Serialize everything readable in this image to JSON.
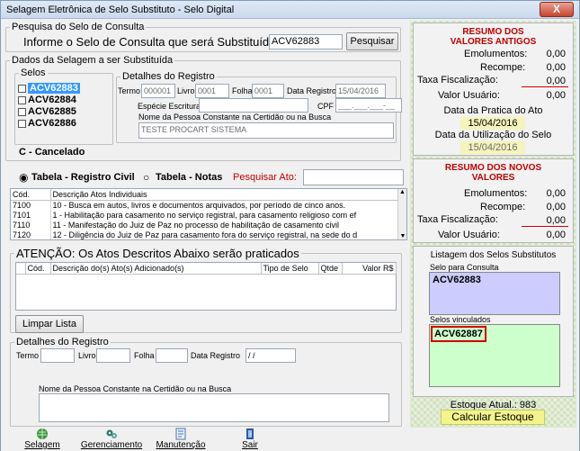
{
  "window": {
    "title": "Selagem Eletrônica de Selo Substituto - Selo Digital",
    "close_label": "X"
  },
  "pesquisa": {
    "legend": "Pesquisa do Selo de Consulta",
    "prompt": "Informe o Selo de Consulta que será Substituído:",
    "value": "ACV62883",
    "button": "Pesquisar"
  },
  "dados": {
    "legend": "Dados da Selagem a ser Substituída",
    "selos_legend": "Selos",
    "selos": [
      "ACV62883",
      "ACV62884",
      "ACV62885",
      "ACV62886"
    ],
    "cancelado": "C - Cancelado",
    "detalhes_legend": "Detalhes do Registro",
    "termo_label": "Termo",
    "termo_value": "000001",
    "livro_label": "Livro",
    "livro_value": "0001",
    "folha_label": "Folha",
    "folha_value": "0001",
    "data_registro_label": "Data Registro",
    "data_registro_value": "15/04/2016",
    "especie_label": "Espécie Escritura",
    "especie_value": "",
    "cpf_label": "CPF",
    "cpf_value": "___.___.___-__",
    "nome_label": "Nome da Pessoa Constante na Certidão ou na Busca",
    "nome_value": "TESTE PROCART SISTEMA"
  },
  "tabela": {
    "radio_civil": "Tabela - Registro Civil",
    "radio_notas": "Tabela - Notas",
    "pesquisar_label": "Pesquisar Ato:",
    "pesquisar_value": "",
    "col_cod": "Cód.",
    "col_desc": "Descrição Atos Individuais",
    "rows": [
      {
        "cod": "7100",
        "desc": "10 - Busca em autos, livros e documentos arquivados, por período de cinco anos."
      },
      {
        "cod": "7101",
        "desc": "1 - Habilitação para casamento no serviço registral, para casamento religioso com ef"
      },
      {
        "cod": "7110",
        "desc": "11 - Manifestação do Juiz de Paz no processo de habilitação de casamento civil"
      },
      {
        "cod": "7120",
        "desc": "12 - Diligência do Juiz de Paz para casamento fora do serviço registral, na sede do d"
      }
    ]
  },
  "atencao": {
    "legend": "ATENÇÃO: Os Atos Descritos Abaixo serão praticados",
    "cols": [
      "Cód.",
      "Descrição do(s) Ato(s) Adicionado(s)",
      "Tipo de Selo",
      "Qtde",
      "Valor R$"
    ],
    "limpar": "Limpar Lista"
  },
  "detalhes2": {
    "legend": "Detalhes do Registro",
    "termo_label": "Termo",
    "livro_label": "Livro",
    "folha_label": "Folha",
    "data_registro_label": "Data Registro",
    "data_registro_value": " / /",
    "nome_label": "Nome da Pessoa Constante na Certidão ou na Busca"
  },
  "resumo_antigos": {
    "title": "RESUMO DOS VALORES ANTIGOS",
    "emolumentos_label": "Emolumentos:",
    "emolumentos": "0,00",
    "recompe_label": "Recompe:",
    "recompe": "0,00",
    "taxa_label": "Taxa Fiscalização:",
    "taxa": "0,00",
    "usuario_label": "Valor Usuário:",
    "usuario": "0,00",
    "data_pratica_label": "Data da Pratica do Ato",
    "data_pratica": "15/04/2016",
    "data_utilizacao_label": "Data da Utilização do Selo",
    "data_utilizacao": "15/04/2016"
  },
  "resumo_novos": {
    "title": "RESUMO DOS NOVOS VALORES",
    "emolumentos_label": "Emolumentos:",
    "emolumentos": "0,00",
    "recompe_label": "Recompe:",
    "recompe": "0,00",
    "taxa_label": "Taxa Fiscalização:",
    "taxa": "0,00",
    "usuario_label": "Valor Usuário:",
    "usuario": "0,00"
  },
  "listagem": {
    "title": "Listagem dos Selos Substitutos",
    "consulta_label": "Selo para Consulta",
    "consulta_value": "ACV62883",
    "vinculados_label": "Selos vinculados",
    "vinculados_value": "ACV62887"
  },
  "estoque": {
    "label": "Estoque Atual.: 983",
    "button": "Calcular Estoque"
  },
  "toolbar": {
    "selagem": "Selagem",
    "gerenciamento": "Gerenciamento",
    "manutencao": "Manutenção",
    "sair": "Sair"
  },
  "colors": {
    "accent_red": "#c00000",
    "consulta_bg": "#ccccff",
    "vinculados_bg": "#ccffcc",
    "date_bg": "#f4f4bb"
  }
}
